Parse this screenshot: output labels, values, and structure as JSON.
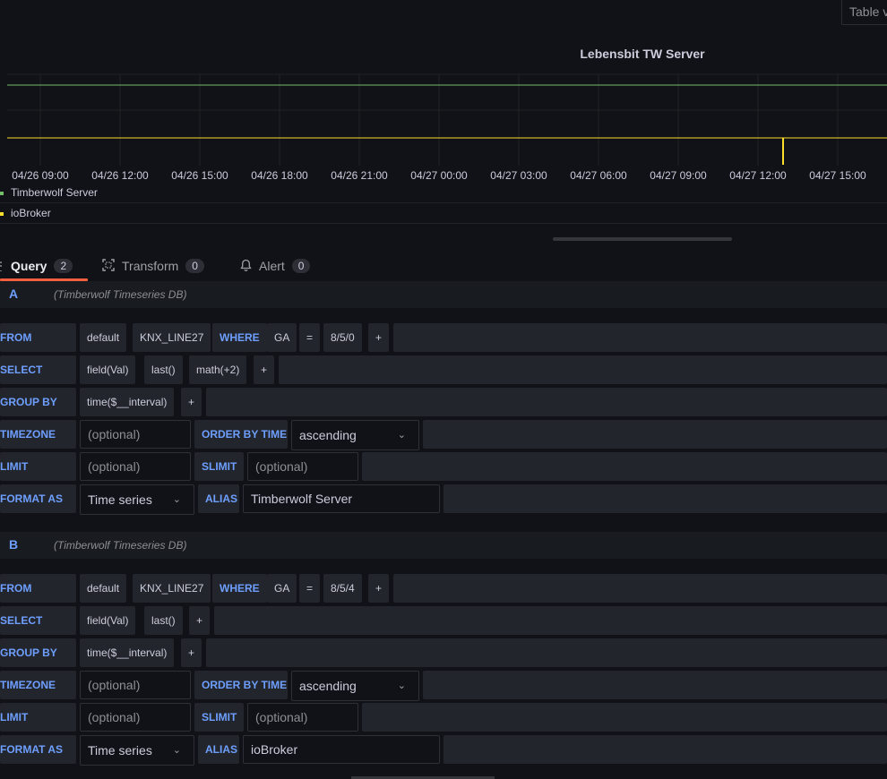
{
  "panel": {
    "table_view_label": "Table v",
    "title": "Lebensbit TW Server"
  },
  "chart_data": {
    "type": "line",
    "title": "Lebensbit TW Server",
    "x_ticks": [
      "04/26 09:00",
      "04/26 12:00",
      "04/26 15:00",
      "04/26 18:00",
      "04/26 21:00",
      "04/27 00:00",
      "04/27 03:00",
      "04/27 06:00",
      "04/27 09:00",
      "04/27 12:00",
      "04/27 15:00"
    ],
    "series": [
      {
        "name": "Timberwolf Server",
        "color": "#73bf69",
        "level": "high",
        "spike_near": null
      },
      {
        "name": "ioBroker",
        "color": "#fade2a",
        "level": "low",
        "spike_near": "04/27 13:00"
      }
    ],
    "grid": true,
    "legend_placement": "bottom-left"
  },
  "legend": [
    {
      "name": "Timberwolf Server",
      "color": "#73bf69"
    },
    {
      "name": "ioBroker",
      "color": "#fade2a"
    }
  ],
  "tabs": [
    {
      "icon": "database-icon",
      "label": "Query",
      "count": "2",
      "active": true
    },
    {
      "icon": "transform-icon",
      "label": "Transform",
      "count": "0",
      "active": false
    },
    {
      "icon": "bell-icon",
      "label": "Alert",
      "count": "0",
      "active": false
    }
  ],
  "queries": [
    {
      "letter": "A",
      "datasource": "(Timberwolf Timeseries DB)",
      "from": {
        "kw": "FROM",
        "policy": "default",
        "measurement": "KNX_LINE27",
        "where": "WHERE",
        "tag": "GA",
        "op": "=",
        "value": "8/5/0",
        "plus": "+"
      },
      "select": {
        "kw": "SELECT",
        "parts": [
          "field(Val)",
          "last()",
          "math(+2)"
        ],
        "plus": "+"
      },
      "group_by": {
        "kw": "GROUP BY",
        "parts": [
          "time($__interval)"
        ],
        "plus": "+"
      },
      "timezone": {
        "kw": "TIMEZONE",
        "placeholder": "(optional)",
        "order_kw": "ORDER BY TIME",
        "order_value": "ascending"
      },
      "limit": {
        "kw": "LIMIT",
        "placeholder": "(optional)",
        "slimit_kw": "SLIMIT",
        "slimit_placeholder": "(optional)"
      },
      "format": {
        "kw": "FORMAT AS",
        "value": "Time series",
        "alias_kw": "ALIAS",
        "alias": "Timberwolf Server"
      }
    },
    {
      "letter": "B",
      "datasource": "(Timberwolf Timeseries DB)",
      "from": {
        "kw": "FROM",
        "policy": "default",
        "measurement": "KNX_LINE27",
        "where": "WHERE",
        "tag": "GA",
        "op": "=",
        "value": "8/5/4",
        "plus": "+"
      },
      "select": {
        "kw": "SELECT",
        "parts": [
          "field(Val)",
          "last()"
        ],
        "plus": "+"
      },
      "group_by": {
        "kw": "GROUP BY",
        "parts": [
          "time($__interval)"
        ],
        "plus": "+"
      },
      "timezone": {
        "kw": "TIMEZONE",
        "placeholder": "(optional)",
        "order_kw": "ORDER BY TIME",
        "order_value": "ascending"
      },
      "limit": {
        "kw": "LIMIT",
        "placeholder": "(optional)",
        "slimit_kw": "SLIMIT",
        "slimit_placeholder": "(optional)"
      },
      "format": {
        "kw": "FORMAT AS",
        "value": "Time series",
        "alias_kw": "ALIAS",
        "alias": "ioBroker"
      }
    }
  ]
}
